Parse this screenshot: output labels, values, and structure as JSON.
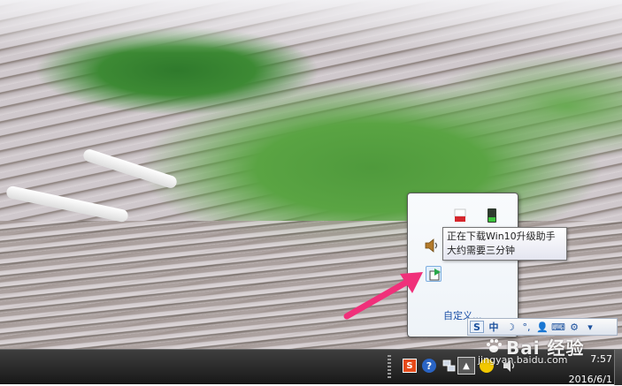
{
  "tray_popup": {
    "customize_label": "自定义..."
  },
  "tooltip": {
    "line1": "正在下载Win10升级助手",
    "line2": "大约需要三分钟"
  },
  "language_bar": {
    "ime_label": "S",
    "lang_label": "中"
  },
  "taskbar": {
    "sogou_label": "S",
    "help_label": "?",
    "time": "7:57",
    "date": "2016/6/1"
  },
  "watermark": {
    "brand": "Bai 经验",
    "url": "jingyan.baidu.com"
  },
  "colors": {
    "arrow": "#f0307a",
    "taskbar": "#262626",
    "link": "#1b4fa6"
  }
}
